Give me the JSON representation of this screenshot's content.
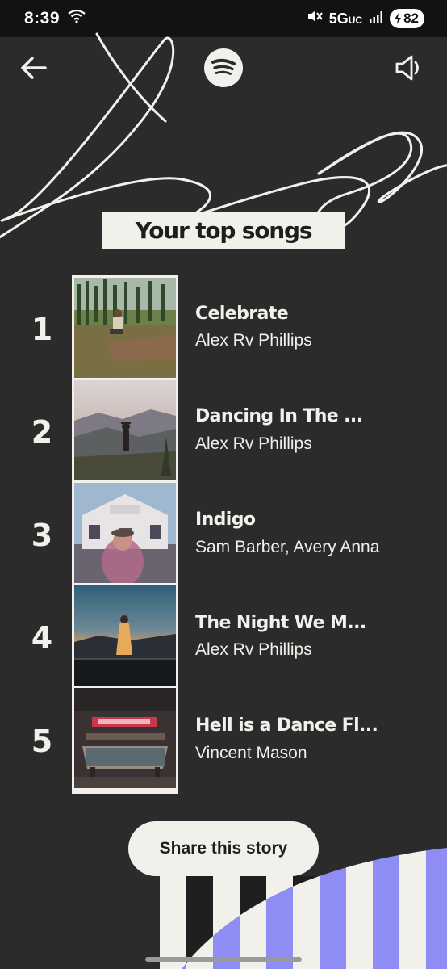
{
  "status_bar": {
    "time": "8:39",
    "network": "5G",
    "network_suffix": "UC",
    "battery": "82",
    "icons": [
      "wifi-icon",
      "mute-icon",
      "signal-icon",
      "battery-icon"
    ]
  },
  "top_bar": {
    "back_icon": "arrow-left-icon",
    "logo_icon": "spotify-logo-icon",
    "sound_icon": "speaker-muted-icon"
  },
  "title": "Your top songs",
  "songs": [
    {
      "rank": "1",
      "title": "Celebrate",
      "artist": "Alex Rv Phillips"
    },
    {
      "rank": "2",
      "title": "Dancing In The ...",
      "artist": "Alex Rv Phillips"
    },
    {
      "rank": "3",
      "title": "Indigo",
      "artist": "Sam Barber, Avery Anna"
    },
    {
      "rank": "4",
      "title": "The Night We M...",
      "artist": "Alex Rv Phillips"
    },
    {
      "rank": "5",
      "title": "Hell is a Dance Fl...",
      "artist": "Vincent Mason"
    }
  ],
  "share_button": "Share this story",
  "colors": {
    "background": "#2b2b2b",
    "cream": "#f2f0eb",
    "stripe_purple": "#8e8cf5",
    "text_dark": "#1e1e1e"
  }
}
